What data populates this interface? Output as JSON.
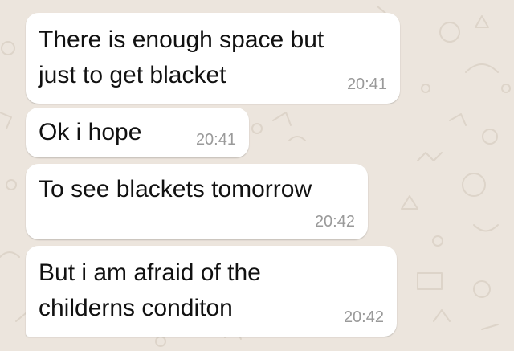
{
  "chat": {
    "background_color": "#ece5dd",
    "bubble_color": "#ffffff",
    "text_color": "#111111",
    "time_color": "#9a9a9a",
    "messages": [
      {
        "text": "There is enough space but\njust to get blacket",
        "time": "20:41"
      },
      {
        "text": "Ok i hope",
        "time": "20:41"
      },
      {
        "text": "To see blackets tomorrow",
        "time": "20:42"
      },
      {
        "text": "But i am afraid of the\nchilderns conditon",
        "time": "20:42"
      }
    ]
  }
}
